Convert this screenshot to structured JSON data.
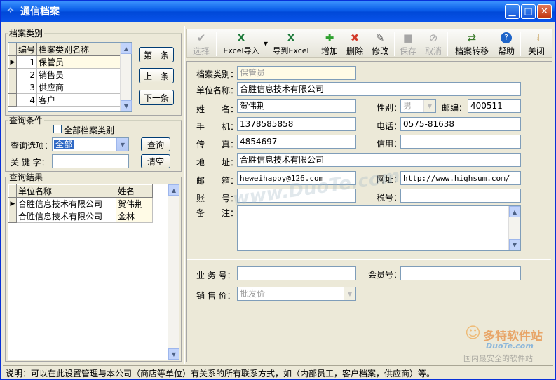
{
  "window": {
    "title": "通信档案"
  },
  "categories": {
    "group_title": "档案类别",
    "headers": [
      "编号",
      "档案类别名称"
    ],
    "rows": [
      {
        "no": "1",
        "name": "保管员"
      },
      {
        "no": "2",
        "name": "销售员"
      },
      {
        "no": "3",
        "name": "供应商"
      },
      {
        "no": "4",
        "name": "客户"
      }
    ],
    "buttons": {
      "first": "第一条",
      "prev": "上一条",
      "next": "下一条"
    }
  },
  "query": {
    "group_title": "查询条件",
    "all_categories_label": "全部档案类别",
    "option_label": "查询选项：",
    "option_value": "全部",
    "keyword_label": "关 键 字：",
    "keyword_value": "",
    "search_button": "查询",
    "clear_button": "清空"
  },
  "results": {
    "group_title": "查询结果",
    "headers": [
      "单位名称",
      "姓名"
    ],
    "rows": [
      {
        "company": "合胜信息技术有限公司",
        "name": "贺伟荆"
      },
      {
        "company": "合胜信息技术有限公司",
        "name": "金林"
      }
    ]
  },
  "toolbar": {
    "select": "选择",
    "excel_import": "Excel导入",
    "export_excel": "导到Excel",
    "add": "增加",
    "delete": "删除",
    "edit": "修改",
    "save": "保存",
    "cancel": "取消",
    "transfer": "档案转移",
    "help": "帮助",
    "close": "关闭"
  },
  "form": {
    "category_label": "档案类别：",
    "category_value": "保管员",
    "company_label": "单位名称：",
    "company_value": "合胜信息技术有限公司",
    "name_label": "姓　　名：",
    "name_value": "贺伟荆",
    "gender_label": "性别：",
    "gender_value": "男",
    "postcode_label": "邮编：",
    "postcode_value": "400511",
    "mobile_label": "手　　机：",
    "mobile_value": "1378585858",
    "phone_label": "电话：",
    "phone_value": "0575-81638",
    "fax_label": "传　　真：",
    "fax_value": "4854697",
    "credit_label": "信用：",
    "credit_value": "",
    "address_label": "地　　址：",
    "address_value": "合胜信息技术有限公司",
    "email_label": "邮　　箱：",
    "email_value": "heweihappy@126.com",
    "website_label": "网址：",
    "website_value": "http://www.highsum.com/",
    "account_label": "账　　号：",
    "account_value": "",
    "tax_label": "税号：",
    "tax_value": "",
    "note_label": "备　　注：",
    "note_value": "",
    "business_no_label": "业 务 号：",
    "business_no_value": "",
    "member_no_label": "会员号：",
    "member_no_value": "",
    "price_label": "销 售 价：",
    "price_value": "批发价"
  },
  "status": {
    "text": "说明：可以在此设置管理与本公司（商店等单位）有关系的所有联系方式，如（内部员工，客户档案，供应商）等。"
  },
  "watermarks": {
    "duote": "www.DuoTe.com",
    "logo_text": "多特软件站",
    "logo_sub": "DuoTe.com",
    "logo_caption": "国内最安全的软件站"
  },
  "colors": {
    "titlebar": "#0a5de8",
    "window_bg": "#ece9d8",
    "readonly_bg": "#fffbe6",
    "border": "#7f9db9"
  }
}
